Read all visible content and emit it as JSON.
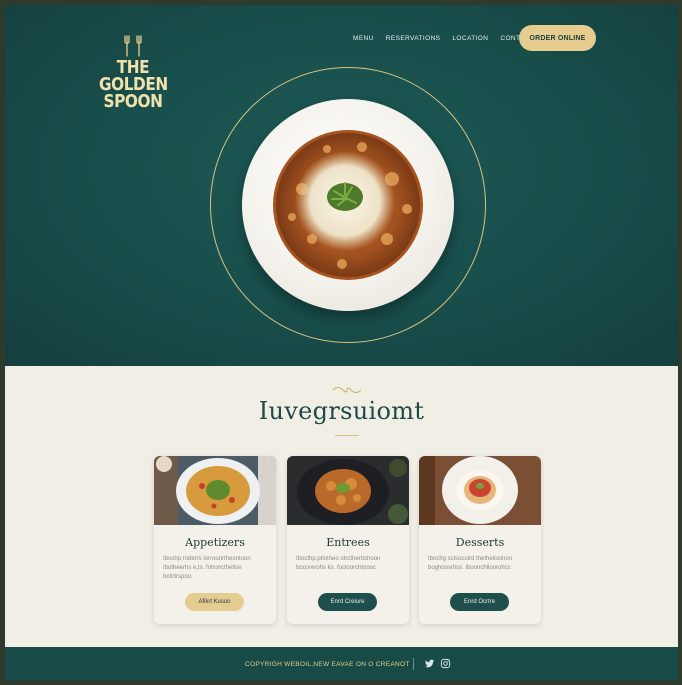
{
  "brand": {
    "logo_lines": [
      "THE",
      "GOLDEN",
      "SPOON"
    ],
    "gold": "#e6cc8f",
    "teal": "#184d4a"
  },
  "nav": {
    "items": [
      "MENU",
      "RESERVATIONS",
      "LOCATION",
      "CONTACT"
    ],
    "order_button": "ORDER ONLINE"
  },
  "section": {
    "title": "Iuvegrsuiomt"
  },
  "cards": [
    {
      "title": "Appetizers",
      "description": "Ibochp,rnderrs iorroonrtheontoon Ibotheerhs e,ts. fohonctheltse bctirtrspoo.",
      "button": "Afikrl Kusoo"
    },
    {
      "title": "Entrees",
      "description": "Ibocthp,ptlotheo otrctherttshoon boosrerohs ks. focloorchtoooc",
      "button": "Enrd Crelure"
    },
    {
      "title": "Desserts",
      "description": "Ibochg sclsocolrd thethelcetnon boghoosrtiss. Iboonchlloorohcc",
      "button": "Enrd Ocrtre"
    }
  ],
  "footer": {
    "copyright": "COPYRIGH WEBOIL,NEW EAVAE ON O CREANOT",
    "icons": [
      "twitter-icon",
      "instagram-icon"
    ]
  }
}
